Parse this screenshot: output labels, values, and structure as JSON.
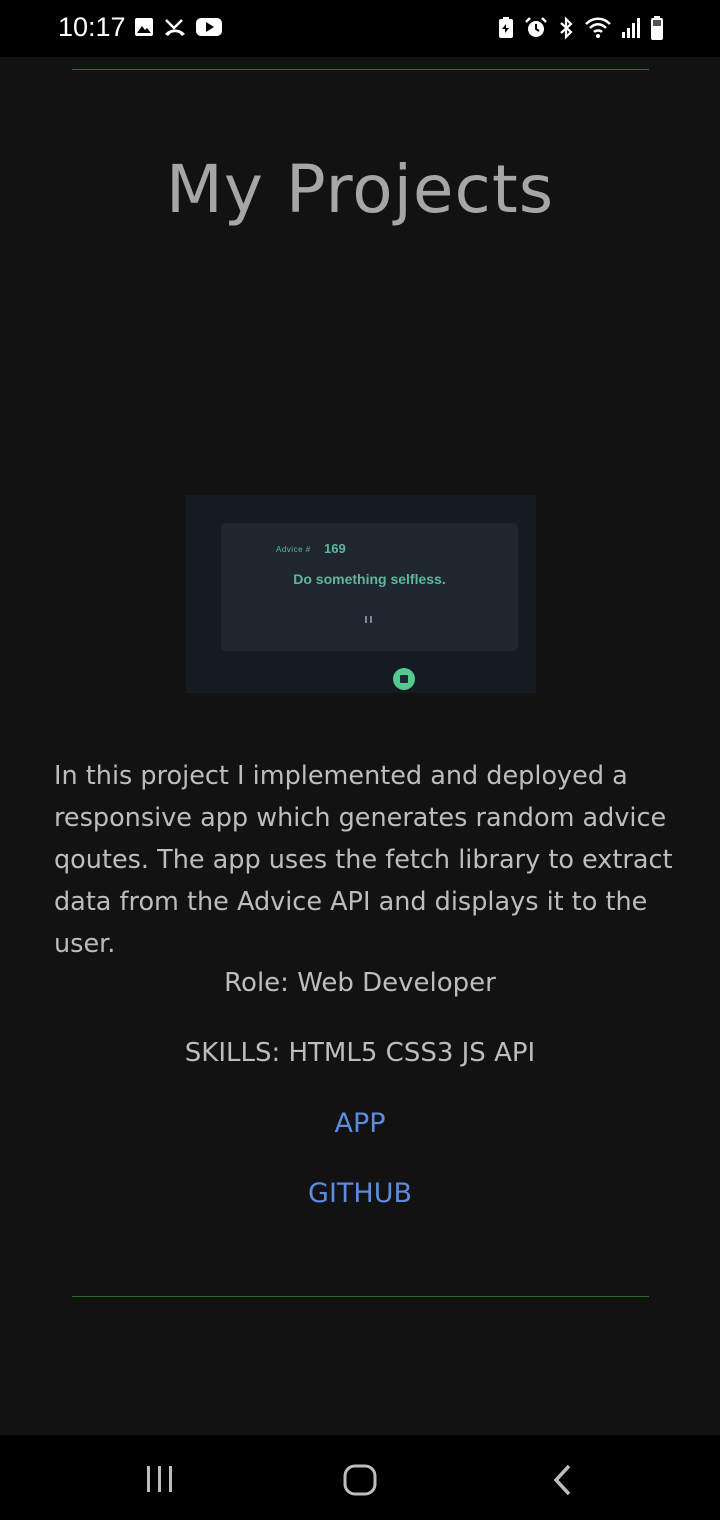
{
  "status_bar": {
    "time": "10:17",
    "left_icons": [
      "image-icon",
      "missed-call-icon",
      "youtube-icon"
    ],
    "right_icons": [
      "battery-saver-icon",
      "alarm-icon",
      "bluetooth-icon",
      "wifi-icon",
      "signal-icon",
      "battery-icon"
    ]
  },
  "page": {
    "title": "My Projects"
  },
  "project": {
    "preview": {
      "advice_label": "Advice #",
      "advice_number": "169",
      "advice_text": "Do something selfless.",
      "accent_color": "#52c98f"
    },
    "description": "In this project I implemented and deployed a responsive app which generates random advice qoutes. The app uses the fetch library to extract data from the Advice API and displays it to the user.",
    "role": "Role: Web Developer",
    "skills": "SKILLS: HTML5 CSS3 JS API",
    "links": {
      "app": "APP",
      "github": "GITHUB"
    }
  },
  "colors": {
    "background": "#121212",
    "divider": "#2e6b2e",
    "link": "#5d8be0",
    "text": "#bdbdbd"
  },
  "nav_bar": {
    "buttons": [
      "recents-icon",
      "home-icon",
      "back-icon"
    ]
  }
}
